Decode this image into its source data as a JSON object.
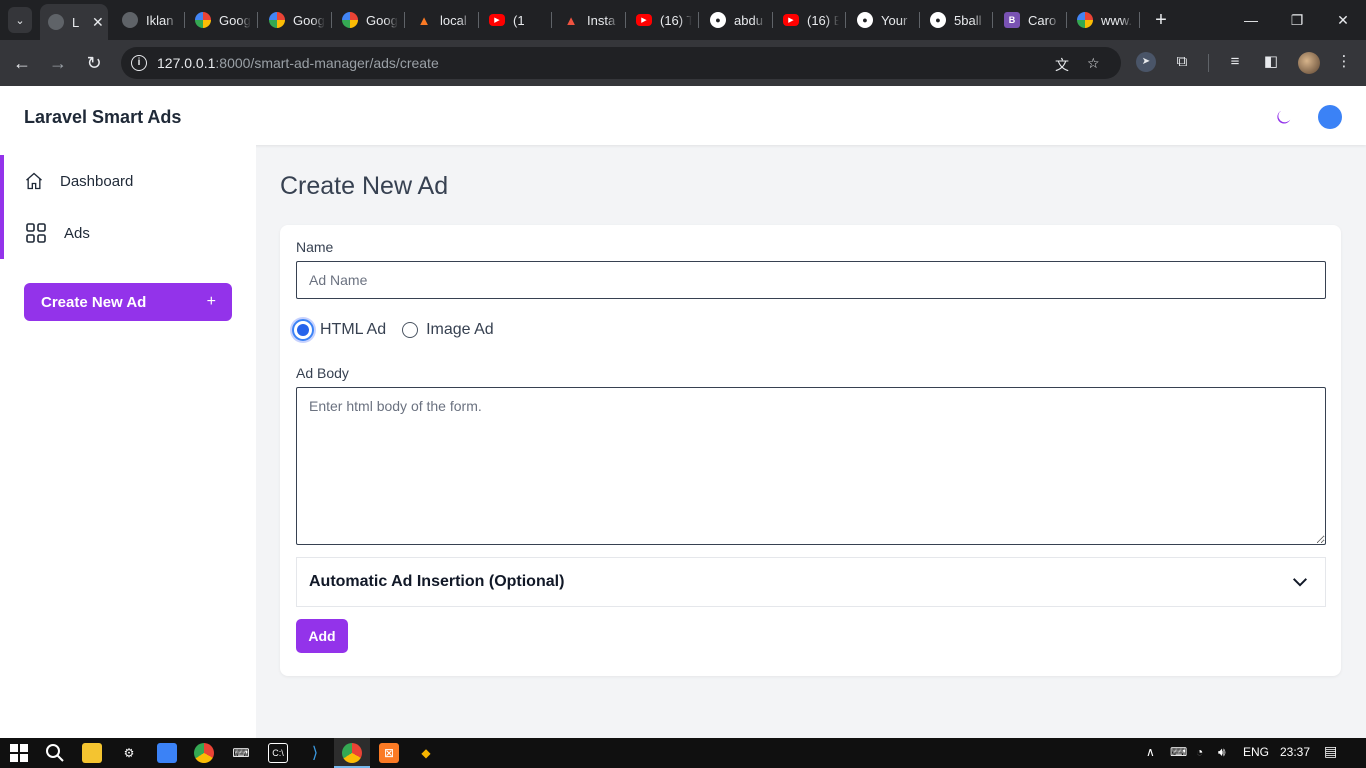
{
  "browser": {
    "tabs": [
      {
        "title": "L",
        "favicon": "globe-icon",
        "color": "#5f6368",
        "active": true
      },
      {
        "title": "Iklan",
        "favicon": "globe-icon",
        "color": "#5f6368"
      },
      {
        "title": "Goog",
        "favicon": "google-icon",
        "color": "#ffffff"
      },
      {
        "title": "Goog",
        "favicon": "google-icon",
        "color": "#ffffff"
      },
      {
        "title": "Goog",
        "favicon": "google-icon",
        "color": "#ffffff"
      },
      {
        "title": "local",
        "favicon": "xampp-icon",
        "color": "#fb7a24"
      },
      {
        "title": "(1",
        "favicon": "youtube-icon",
        "color": "#ff0000"
      },
      {
        "title": "Insta",
        "favicon": "laravel-icon",
        "color": "#f05340"
      },
      {
        "title": "(16) T",
        "favicon": "youtube-icon",
        "color": "#ff0000"
      },
      {
        "title": "abdu",
        "favicon": "github-icon",
        "color": "#ffffff"
      },
      {
        "title": "(16) E",
        "favicon": "youtube-icon",
        "color": "#ff0000"
      },
      {
        "title": "Your",
        "favicon": "github-icon",
        "color": "#ffffff"
      },
      {
        "title": "5ball",
        "favicon": "github-icon",
        "color": "#ffffff"
      },
      {
        "title": "Caro",
        "favicon": "bootstrap-icon",
        "color": "#7952b3"
      },
      {
        "title": "www.",
        "favicon": "google-icon",
        "color": "#ffffff"
      }
    ],
    "url_host": "127.0.0.1",
    "url_path": ":8000/smart-ad-manager/ads/create"
  },
  "app": {
    "brand": "Laravel Smart Ads",
    "accent_color": "#9333ea",
    "sidebar": {
      "items": [
        {
          "label": "Dashboard",
          "icon": "home-icon"
        },
        {
          "label": "Ads",
          "icon": "grid-icon"
        }
      ],
      "create_button": "Create New Ad",
      "create_button_icon": "+"
    },
    "main": {
      "title": "Create New Ad",
      "form": {
        "name_label": "Name",
        "name_placeholder": "Ad Name",
        "radio_html": "HTML Ad",
        "radio_image": "Image Ad",
        "selected_type": "HTML Ad",
        "body_label": "Ad Body",
        "body_placeholder": "Enter html body of the form.",
        "accordion_title": "Automatic Ad Insertion (Optional)",
        "submit": "Add"
      }
    }
  },
  "taskbar": {
    "language": "ENG",
    "time": "23:37"
  }
}
